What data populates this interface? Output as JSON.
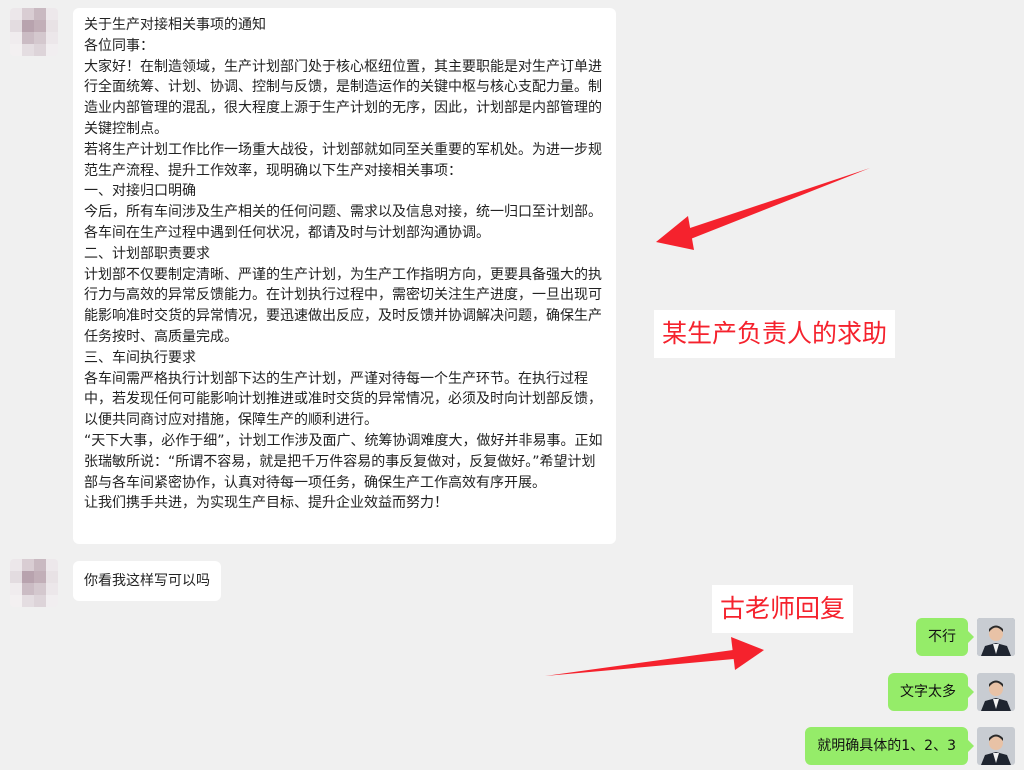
{
  "incoming": {
    "notice_lines": [
      "关于生产对接相关事项的通知",
      "各位同事：",
      "大家好！在制造领域，生产计划部门处于核心枢纽位置，其主要职能是对生产订单进行全面统筹、计划、协调、控制与反馈，是制造运作的关键中枢与核心支配力量。制造业内部管理的混乱，很大程度上源于生产计划的无序，因此，计划部是内部管理的关键控制点。",
      "若将生产计划工作比作一场重大战役，计划部就如同至关重要的军机处。为进一步规范生产流程、提升工作效率，现明确以下生产对接相关事项：",
      "一、对接归口明确",
      "今后，所有车间涉及生产相关的任何问题、需求以及信息对接，统一归口至计划部。各车间在生产过程中遇到任何状况，都请及时与计划部沟通协调。",
      "二、计划部职责要求",
      "计划部不仅要制定清晰、严谨的生产计划，为生产工作指明方向，更要具备强大的执行力与高效的异常反馈能力。在计划执行过程中，需密切关注生产进度，一旦出现可能影响准时交货的异常情况，要迅速做出反应，及时反馈并协调解决问题，确保生产任务按时、高质量完成。",
      "三、车间执行要求",
      "各车间需严格执行计划部下达的生产计划，严谨对待每一个生产环节。在执行过程中，若发现任何可能影响计划推进或准时交货的异常情况，必须及时向计划部反馈，以便共同商讨应对措施，保障生产的顺利进行。",
      "“天下大事，必作于细”，计划工作涉及面广、统筹协调难度大，做好并非易事。正如张瑞敏所说：“所谓不容易，就是把千万件容易的事反复做对，反复做好。”希望计划部与各车间紧密协作，认真对待每一项任务，确保生产工作高效有序开展。",
      "让我们携手共进，为实现生产目标、提升企业效益而努力！"
    ],
    "question": "你看我这样写可以吗"
  },
  "outgoing": [
    "不行",
    "文字太多",
    "就明确具体的1、2、3"
  ],
  "annotations": {
    "top": "某生产负责人的求助",
    "bottom": "古老师回复"
  },
  "colors": {
    "chat_bg": "#f0f0f0",
    "incoming_bubble": "#ffffff",
    "outgoing_bubble": "#95ec69",
    "annotation_text": "#f5222d",
    "arrow": "#f5222d"
  }
}
